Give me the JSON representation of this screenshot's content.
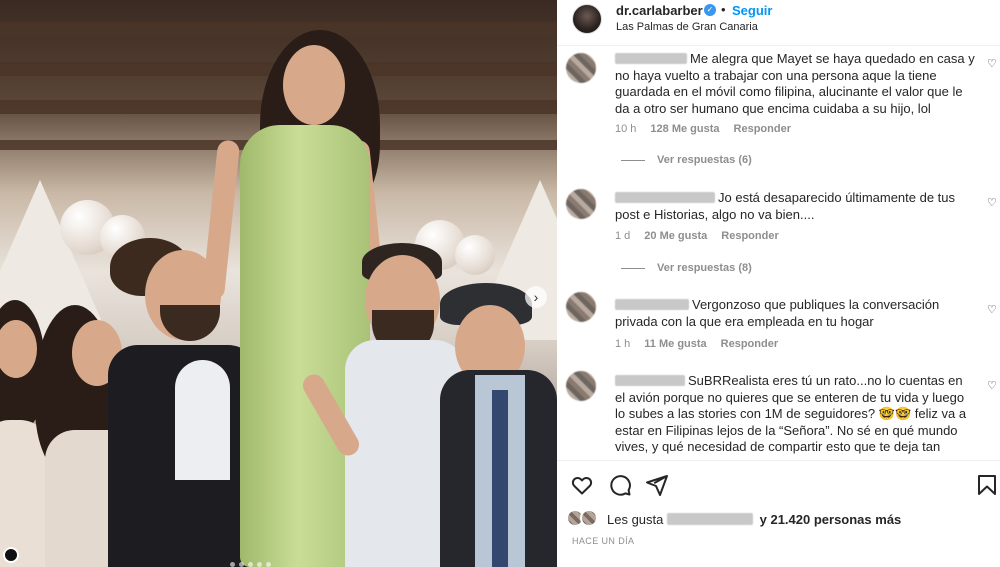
{
  "post": {
    "username": "dr.carlabarber",
    "follow_label": "Seguir",
    "separator": "•",
    "location": "Las Palmas de Gran Canaria"
  },
  "comments": [
    {
      "text": "Me alegra que Mayet se haya quedado en casa y no haya vuelto a trabajar con una persona aque la tiene guardada en el móvil como filipina, alucinante el valor que le da a otro ser humano que encima cuidaba a su hijo, lol",
      "time": "10 h",
      "likes": "128 Me gusta",
      "reply_label": "Responder",
      "view_replies": "Ver respuestas (6)"
    },
    {
      "text": "Jo está desaparecido últimamente de tus post e Historias, algo no va bien....",
      "time": "1 d",
      "likes": "20 Me gusta",
      "reply_label": "Responder",
      "view_replies": "Ver respuestas (8)"
    },
    {
      "text": "Vergonzoso que publiques la conversación privada con la que era empleada en tu hogar",
      "time": "1 h",
      "likes": "11 Me gusta",
      "reply_label": "Responder"
    },
    {
      "text": "SuBRRealista eres tú un rato...no lo cuentas en el avión porque no quieres que se enteren de tu vida y luego lo subes a las stories con 1M de seguidores? 🤓🤓 feliz va a estar en Filipinas lejos de la “Señora”. No sé en qué mundo vives, y qué necesidad de compartir esto que te deja tan"
    }
  ],
  "footer": {
    "likes_prefix": "Les gusta",
    "likes_suffix": "y 21.420 personas más",
    "time_ago": "HACE UN DÍA"
  },
  "icons": {
    "like": "heart-icon",
    "comment": "comment-icon",
    "share": "paper-plane-icon",
    "save": "bookmark-icon",
    "verified": "verified-badge-icon",
    "next": "chevron-right-icon"
  },
  "colors": {
    "link_blue": "#0095f6",
    "verified_blue": "#3897f0",
    "meta_gray": "#8e8e8e",
    "text": "#262626"
  }
}
